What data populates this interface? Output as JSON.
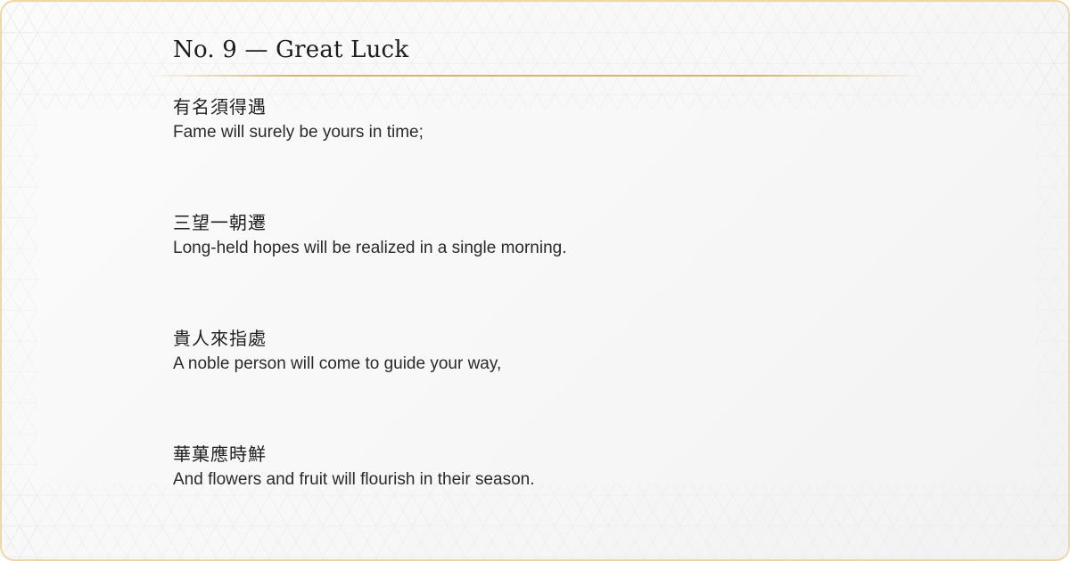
{
  "header": {
    "title": "No. 9 — Great Luck"
  },
  "verses": [
    {
      "cn": "有名須得遇",
      "en": "Fame will surely be yours in time;"
    },
    {
      "cn": "三望一朝遷",
      "en": "Long-held hopes will be realized in a single morning."
    },
    {
      "cn": "貴人來指處",
      "en": "A noble person will come to guide your way,"
    },
    {
      "cn": "華菓應時鮮",
      "en": "And flowers and fruit will flourish in their season."
    }
  ],
  "colors": {
    "border": "#ecd9a8",
    "divider": "#d9b567",
    "text": "#1f1f1f",
    "background": "#f8f8f8"
  }
}
